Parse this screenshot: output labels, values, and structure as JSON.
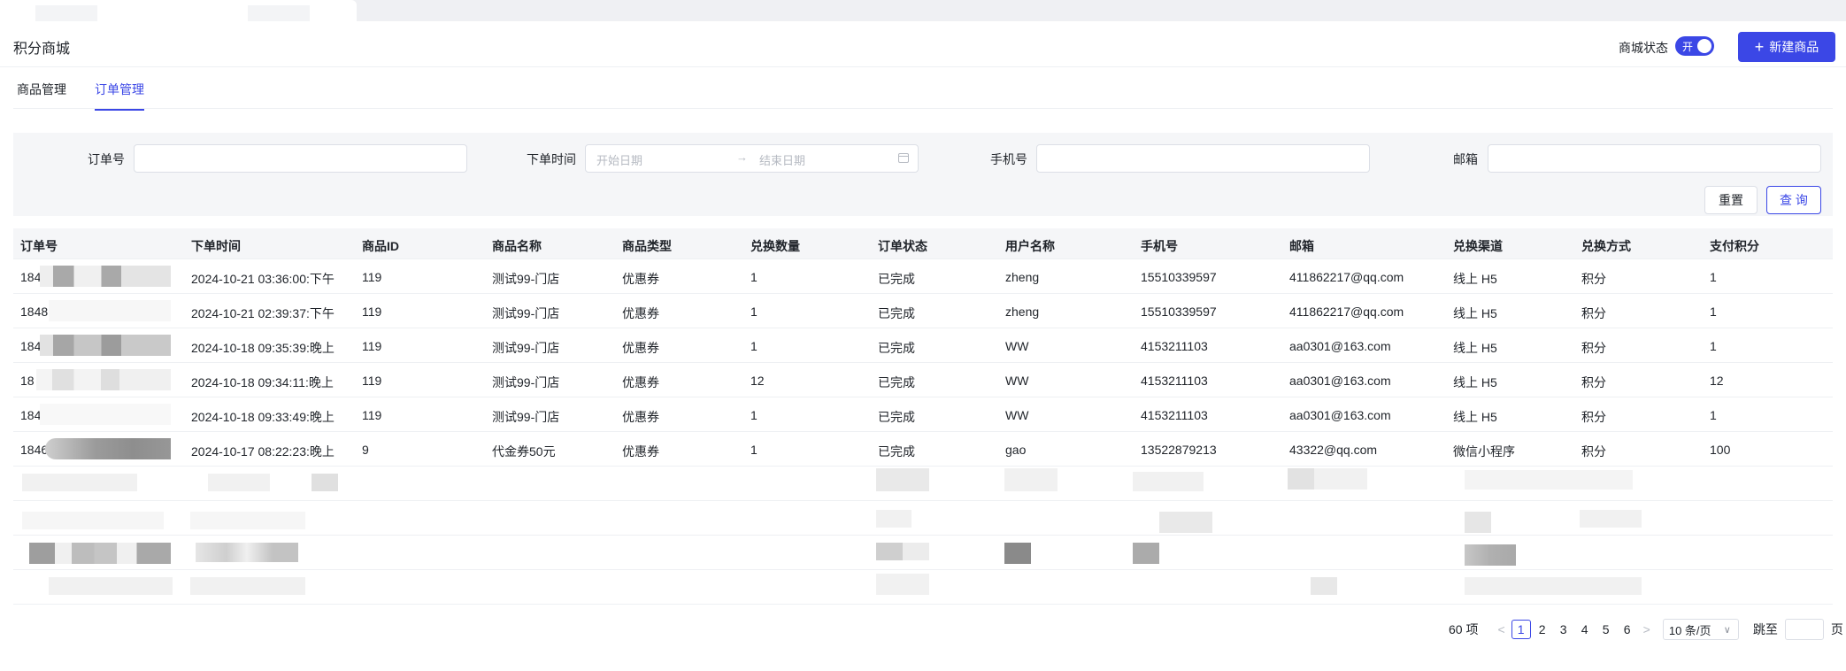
{
  "header": {
    "title": "积分商城",
    "status_label": "商城状态",
    "toggle_text": "开",
    "new_button_label": "新建商品"
  },
  "tabs": [
    {
      "label": "商品管理",
      "active": false
    },
    {
      "label": "订单管理",
      "active": true
    }
  ],
  "filters": {
    "order_no_label": "订单号",
    "order_no_value": "",
    "time_label": "下单时间",
    "start_placeholder": "开始日期",
    "end_placeholder": "结束日期",
    "phone_label": "手机号",
    "phone_value": "",
    "email_label": "邮箱",
    "email_value": "",
    "reset_label": "重置",
    "query_label": "查 询"
  },
  "table": {
    "columns": [
      "订单号",
      "下单时间",
      "商品ID",
      "商品名称",
      "商品类型",
      "兑换数量",
      "订单状态",
      "用户名称",
      "手机号",
      "邮箱",
      "兑换渠道",
      "兑换方式",
      "支付积分"
    ],
    "rows": [
      {
        "order_no": "184",
        "time": "2024-10-21 03:36:00:下午",
        "product_id": "119",
        "product_name": "测试99-门店",
        "product_type": "优惠券",
        "qty": "1",
        "status": "已完成",
        "user": "zheng",
        "phone": "15510339597",
        "email": "411862217@qq.com",
        "channel": "线上 H5",
        "method": "积分",
        "points": "1"
      },
      {
        "order_no": "1848",
        "time": "2024-10-21 02:39:37:下午",
        "product_id": "119",
        "product_name": "测试99-门店",
        "product_type": "优惠券",
        "qty": "1",
        "status": "已完成",
        "user": "zheng",
        "phone": "15510339597",
        "email": "411862217@qq.com",
        "channel": "线上 H5",
        "method": "积分",
        "points": "1"
      },
      {
        "order_no": "184",
        "time": "2024-10-18 09:35:39:晚上",
        "product_id": "119",
        "product_name": "测试99-门店",
        "product_type": "优惠券",
        "qty": "1",
        "status": "已完成",
        "user": "WW",
        "phone": "4153211103",
        "email": "aa0301@163.com",
        "channel": "线上 H5",
        "method": "积分",
        "points": "1"
      },
      {
        "order_no": "18",
        "time": "2024-10-18 09:34:11:晚上",
        "product_id": "119",
        "product_name": "测试99-门店",
        "product_type": "优惠券",
        "qty": "12",
        "status": "已完成",
        "user": "WW",
        "phone": "4153211103",
        "email": "aa0301@163.com",
        "channel": "线上 H5",
        "method": "积分",
        "points": "12"
      },
      {
        "order_no": "184",
        "time": "2024-10-18 09:33:49:晚上",
        "product_id": "119",
        "product_name": "测试99-门店",
        "product_type": "优惠券",
        "qty": "1",
        "status": "已完成",
        "user": "WW",
        "phone": "4153211103",
        "email": "aa0301@163.com",
        "channel": "线上 H5",
        "method": "积分",
        "points": "1"
      },
      {
        "order_no": "1846",
        "time": "2024-10-17 08:22:23:晚上",
        "product_id": "9",
        "product_name": "代金券50元",
        "product_type": "优惠券",
        "qty": "1",
        "status": "已完成",
        "user": "gao",
        "phone": "13522879213",
        "email": "43322@qq.com",
        "channel": "微信小程序",
        "method": "积分",
        "points": "100"
      }
    ]
  },
  "pagination": {
    "total": "60 项",
    "pages": [
      "1",
      "2",
      "3",
      "4",
      "5",
      "6"
    ],
    "current": "1",
    "page_size": "10 条/页",
    "jump_label": "跳至",
    "page_suffix": "页"
  },
  "colors": {
    "accent": "#3b47e6",
    "filter_bg": "#f5f6f8"
  }
}
